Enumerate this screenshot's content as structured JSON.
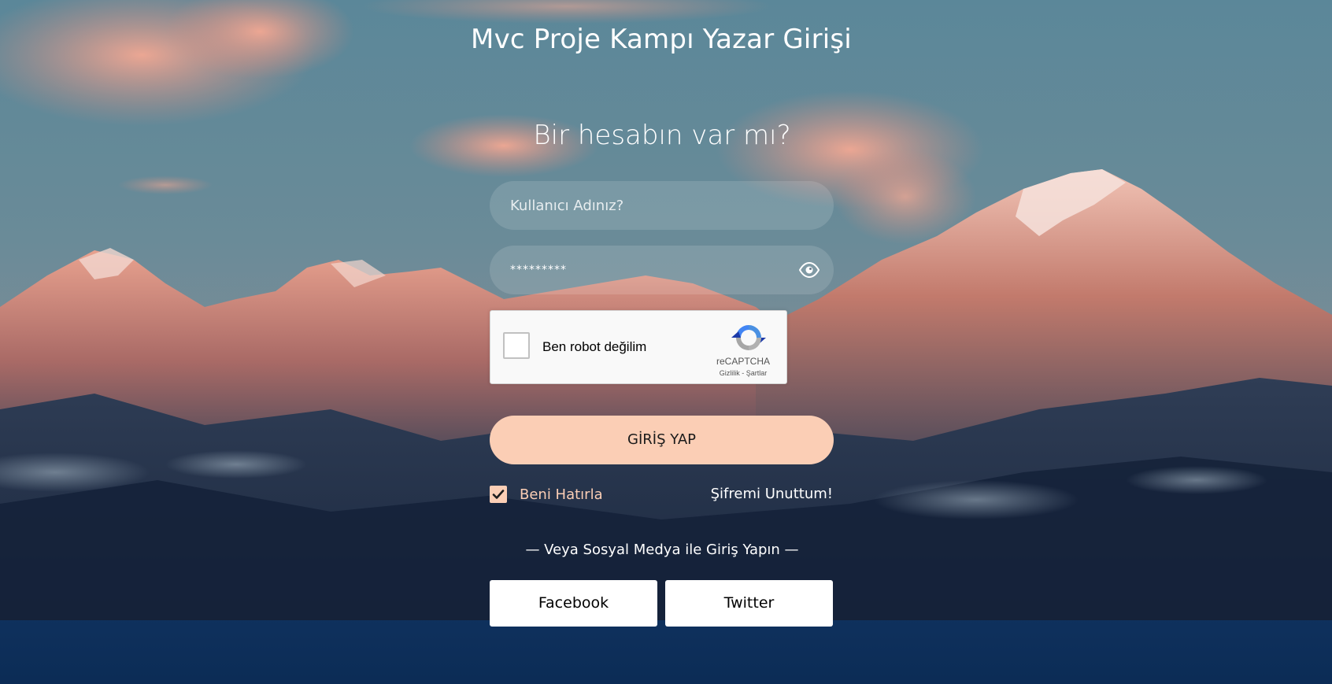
{
  "header": {
    "title": "Mvc Proje Kampı Yazar Girişi"
  },
  "login": {
    "subtitle": "Bir hesabın var mı?",
    "username_placeholder": "Kullanıcı Adınız?",
    "password_value": "*********",
    "password_toggle_icon": "eye-icon"
  },
  "recaptcha": {
    "label": "Ben robot değilim",
    "brand": "reCAPTCHA",
    "privacy": "Gizlilik",
    "separator": " - ",
    "terms": "Şartlar",
    "checked": false
  },
  "actions": {
    "login_label": "GİRİŞ YAP",
    "remember_label": "Beni Hatırla",
    "remember_checked": true,
    "forgot_label": "Şifremi Unuttum!"
  },
  "social": {
    "caption": "— Veya Sosyal Medya ile Giriş Yapın —",
    "facebook_label": "Facebook",
    "twitter_label": "Twitter"
  },
  "colors": {
    "accent": "#fbceb5",
    "sky": "#5c8798",
    "bottom_band": "#0e3260"
  }
}
